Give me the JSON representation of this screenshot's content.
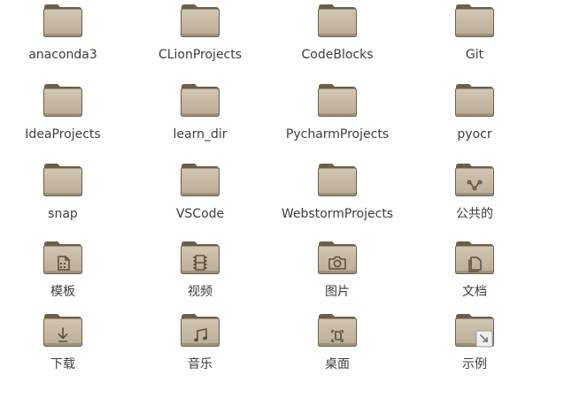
{
  "items": [
    {
      "label": "anaconda3",
      "icon": "folder-icon"
    },
    {
      "label": "CLionProjects",
      "icon": "folder-icon"
    },
    {
      "label": "CodeBlocks",
      "icon": "folder-icon"
    },
    {
      "label": "Git",
      "icon": "folder-icon"
    },
    {
      "label": "IdeaProjects",
      "icon": "folder-icon"
    },
    {
      "label": "learn_dir",
      "icon": "folder-icon"
    },
    {
      "label": "PycharmProjects",
      "icon": "folder-icon"
    },
    {
      "label": "pyocr",
      "icon": "folder-icon"
    },
    {
      "label": "snap",
      "icon": "folder-icon"
    },
    {
      "label": "VSCode",
      "icon": "folder-icon"
    },
    {
      "label": "WebstormProjects",
      "icon": "folder-icon"
    },
    {
      "label": "公共的",
      "icon": "folder-public-share-icon"
    },
    {
      "label": "模板",
      "icon": "folder-templates-icon"
    },
    {
      "label": "视频",
      "icon": "folder-videos-icon"
    },
    {
      "label": "图片",
      "icon": "folder-pictures-icon"
    },
    {
      "label": "文档",
      "icon": "folder-documents-icon"
    },
    {
      "label": "下载",
      "icon": "folder-download-icon"
    },
    {
      "label": "音乐",
      "icon": "folder-music-icon"
    },
    {
      "label": "桌面",
      "icon": "folder-desktop-icon"
    },
    {
      "label": "示例",
      "icon": "folder-symlink-icon"
    }
  ],
  "colors": {
    "folder_light": "#d1c6b2",
    "folder_mid": "#b9ad95",
    "folder_dark": "#6b5f4b",
    "emblem": "#5b5142"
  }
}
